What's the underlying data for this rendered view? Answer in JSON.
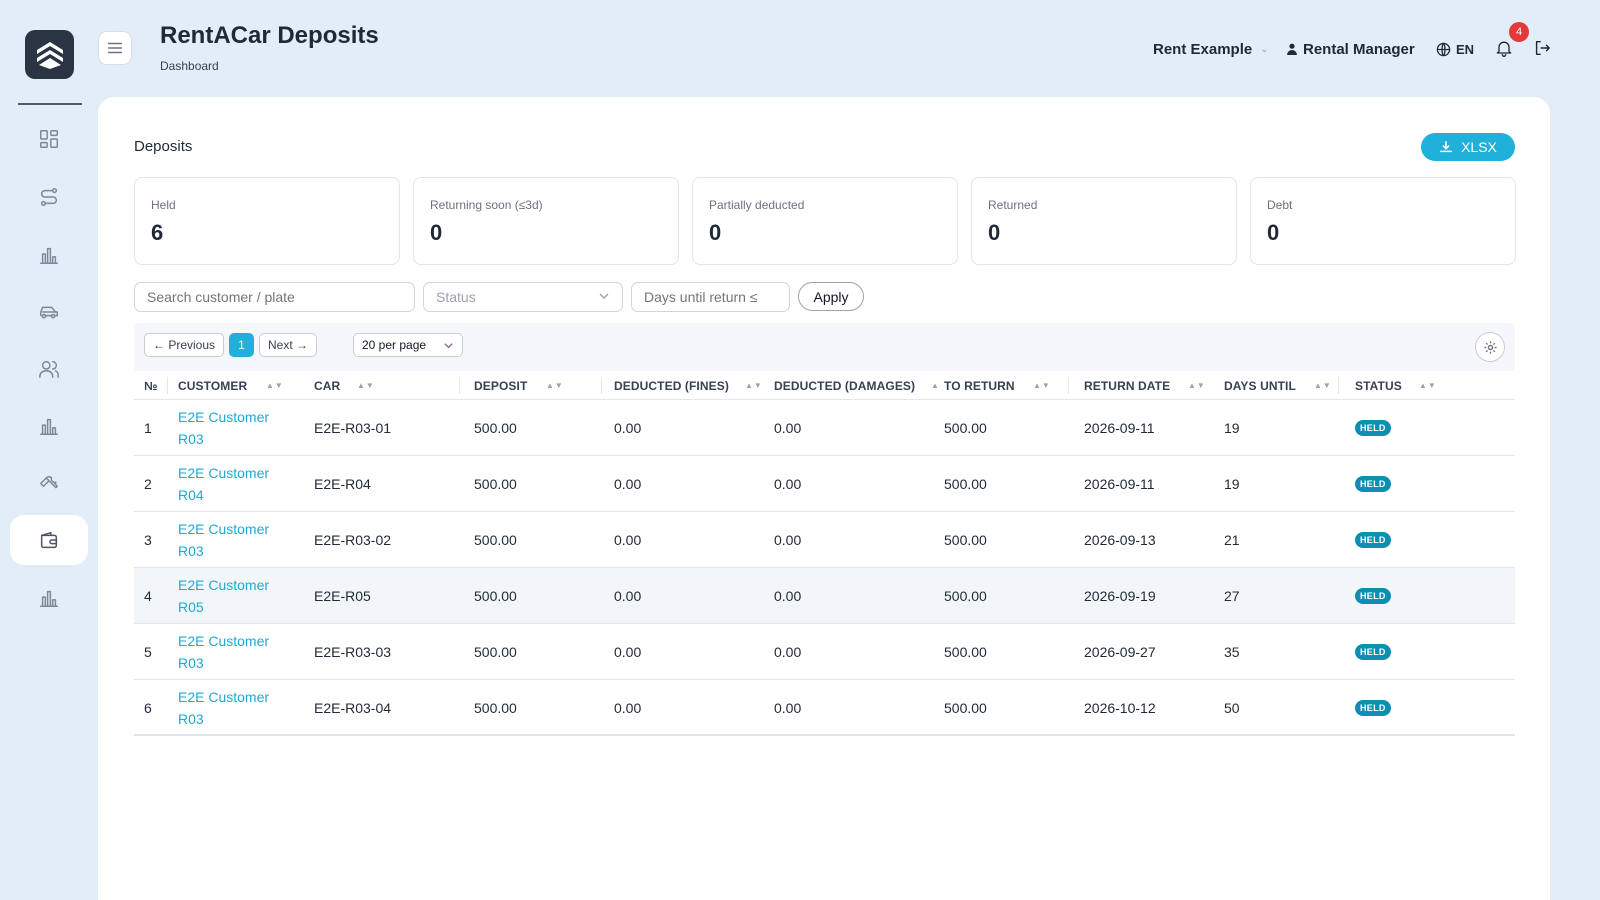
{
  "header": {
    "title": "RentACar Deposits",
    "breadcrumb": "Dashboard",
    "company": "Rent Example",
    "user": "Rental Manager",
    "language": "EN",
    "notification_count": "4"
  },
  "sidebar": {
    "items": [
      {
        "icon": "dashboard-icon",
        "active": false
      },
      {
        "icon": "route-icon",
        "active": false
      },
      {
        "icon": "bar-chart-icon",
        "active": false
      },
      {
        "icon": "car-icon",
        "active": false
      },
      {
        "icon": "users-icon",
        "active": false
      },
      {
        "icon": "bar-chart-icon",
        "active": false
      },
      {
        "icon": "wrench-icon",
        "active": false
      },
      {
        "icon": "wallet-icon",
        "active": true
      },
      {
        "icon": "bar-chart-icon",
        "active": false
      }
    ]
  },
  "main": {
    "section_title": "Deposits",
    "export_label": "XLSX",
    "stats": [
      {
        "label": "Held",
        "value": "6"
      },
      {
        "label": "Returning soon (≤3d)",
        "value": "0"
      },
      {
        "label": "Partially deducted",
        "value": "0"
      },
      {
        "label": "Returned",
        "value": "0"
      },
      {
        "label": "Debt",
        "value": "0"
      }
    ],
    "filters": {
      "search_placeholder": "Search customer / plate",
      "status_placeholder": "Status",
      "days_placeholder": "Days until return ≤",
      "apply_label": "Apply"
    },
    "pagination": {
      "previous": "← Previous",
      "current": "1",
      "next": "Next →",
      "per_page": "20 per page"
    },
    "columns": [
      "№",
      "CUSTOMER",
      "CAR",
      "DEPOSIT",
      "DEDUCTED (FINES)",
      "DEDUCTED (DAMAGES)",
      "TO RETURN",
      "RETURN DATE",
      "DAYS UNTIL",
      "STATUS"
    ],
    "rows": [
      {
        "no": "1",
        "customer_line1": "E2E Customer",
        "customer_line2": "R03",
        "car": "E2E-R03-01",
        "deposit": "500.00",
        "fines": "0.00",
        "damages": "0.00",
        "to_return": "500.00",
        "return_date": "2026-09-11",
        "days_until": "19",
        "status": "HELD"
      },
      {
        "no": "2",
        "customer_line1": "E2E Customer",
        "customer_line2": "R04",
        "car": "E2E-R04",
        "deposit": "500.00",
        "fines": "0.00",
        "damages": "0.00",
        "to_return": "500.00",
        "return_date": "2026-09-11",
        "days_until": "19",
        "status": "HELD"
      },
      {
        "no": "3",
        "customer_line1": "E2E Customer",
        "customer_line2": "R03",
        "car": "E2E-R03-02",
        "deposit": "500.00",
        "fines": "0.00",
        "damages": "0.00",
        "to_return": "500.00",
        "return_date": "2026-09-13",
        "days_until": "21",
        "status": "HELD"
      },
      {
        "no": "4",
        "customer_line1": "E2E Customer",
        "customer_line2": "R05",
        "car": "E2E-R05",
        "deposit": "500.00",
        "fines": "0.00",
        "damages": "0.00",
        "to_return": "500.00",
        "return_date": "2026-09-19",
        "days_until": "27",
        "status": "HELD"
      },
      {
        "no": "5",
        "customer_line1": "E2E Customer",
        "customer_line2": "R03",
        "car": "E2E-R03-03",
        "deposit": "500.00",
        "fines": "0.00",
        "damages": "0.00",
        "to_return": "500.00",
        "return_date": "2026-09-27",
        "days_until": "35",
        "status": "HELD"
      },
      {
        "no": "6",
        "customer_line1": "E2E Customer",
        "customer_line2": "R03",
        "car": "E2E-R03-04",
        "deposit": "500.00",
        "fines": "0.00",
        "damages": "0.00",
        "to_return": "500.00",
        "return_date": "2026-10-12",
        "days_until": "50",
        "status": "HELD"
      }
    ]
  },
  "colors": {
    "accent": "#1fb1d9",
    "status_held": "#0f8fb0",
    "badge": "#e5383b",
    "background": "#e3edf7"
  }
}
